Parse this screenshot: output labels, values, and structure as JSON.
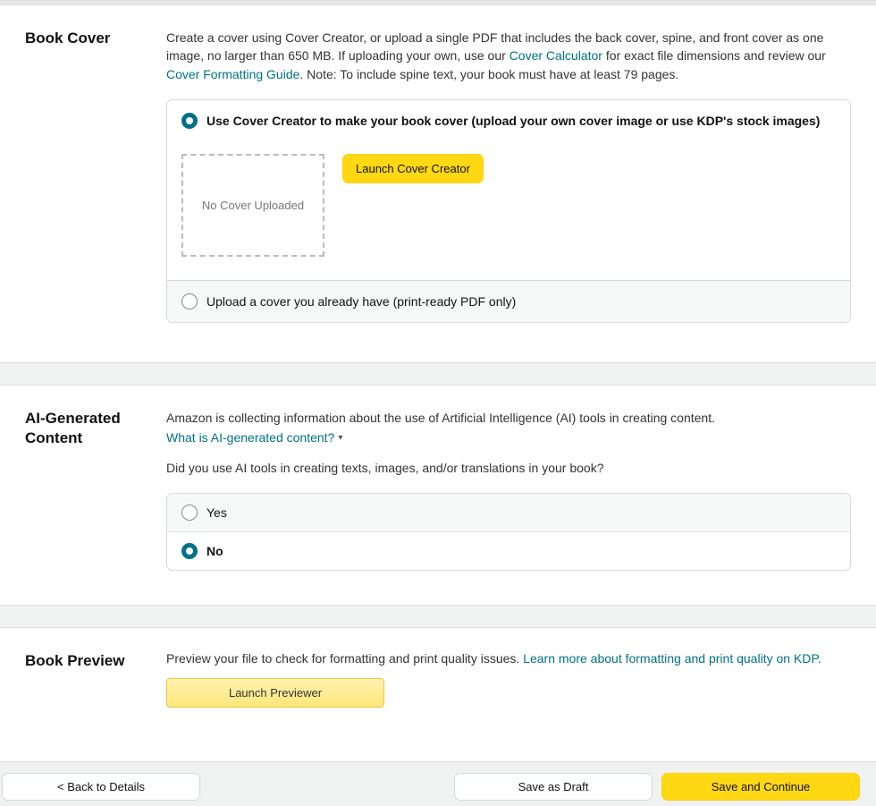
{
  "book_cover": {
    "heading": "Book Cover",
    "desc_1": "Create a cover using Cover Creator, or upload a single PDF that includes the back cover, spine, and front cover as one image, no larger than 650 MB. If uploading your own, use our ",
    "link_calc": "Cover Calculator",
    "desc_2": " for exact file dimensions and review our ",
    "link_guide": "Cover Formatting Guide",
    "desc_3": ". Note: To include spine text, your book must have at least 79 pages.",
    "option_creator": "Use Cover Creator to make your book cover (upload your own cover image or use KDP's stock images)",
    "placeholder_text": "No Cover Uploaded",
    "launch_button": "Launch Cover Creator",
    "option_upload": "Upload a cover you already have (print-ready PDF only)"
  },
  "ai": {
    "heading": "AI-Generated Content",
    "desc": "Amazon is collecting information about the use of Artificial Intelligence (AI) tools in creating content.",
    "help_link": "What is AI-generated content?",
    "question": "Did you use AI tools in creating texts, images, and/or translations in your book?",
    "yes": "Yes",
    "no": "No"
  },
  "preview": {
    "heading": "Book Preview",
    "desc": "Preview your file to check for formatting and print quality issues. ",
    "link": "Learn more about formatting and print quality on KDP.",
    "button": "Launch Previewer"
  },
  "footer": {
    "back": "< Back to Details",
    "draft": "Save as Draft",
    "continue": "Save and Continue"
  }
}
